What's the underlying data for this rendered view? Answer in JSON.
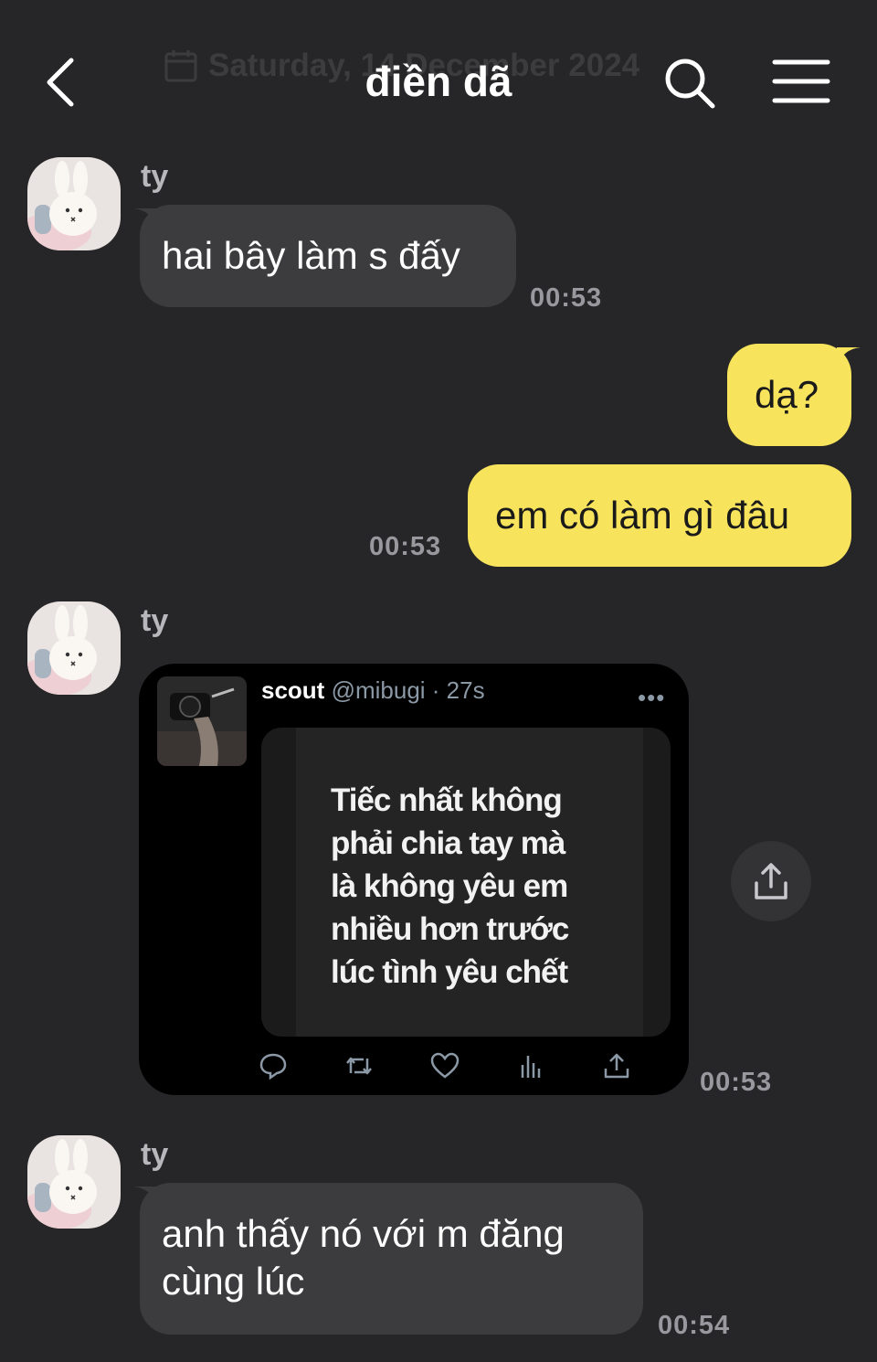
{
  "header": {
    "title": "điền dã",
    "date_ghost": "Saturday, 14 December 2024"
  },
  "messages": [
    {
      "sender": "ty",
      "text": "hai bây làm s đấy",
      "time": "00:53"
    },
    {
      "text": "dạ?"
    },
    {
      "text": "em có làm gì đâu",
      "time": "00:53"
    },
    {
      "sender": "ty",
      "time": "00:53"
    },
    {
      "sender": "ty",
      "line1": "anh thấy nó với m đăng",
      "line2": "cùng lúc",
      "time": "00:54"
    }
  ],
  "tweet": {
    "name": "scout",
    "handle": "@mibugi",
    "age": "· 27s",
    "more": "•••",
    "image_lines": [
      "Tiếc nhất không",
      "phải chia tay mà",
      "là không yêu em",
      "nhiều hơn trước",
      "lúc tình yêu chết"
    ]
  },
  "colors": {
    "background": "#262628",
    "incoming_bubble": "#3c3c3e",
    "outgoing_bubble": "#f8e45c"
  },
  "icons": [
    "back-icon",
    "calendar-icon",
    "search-icon",
    "menu-icon",
    "share-icon",
    "reply-icon",
    "retweet-icon",
    "like-icon",
    "views-icon",
    "tweet-share-icon"
  ]
}
